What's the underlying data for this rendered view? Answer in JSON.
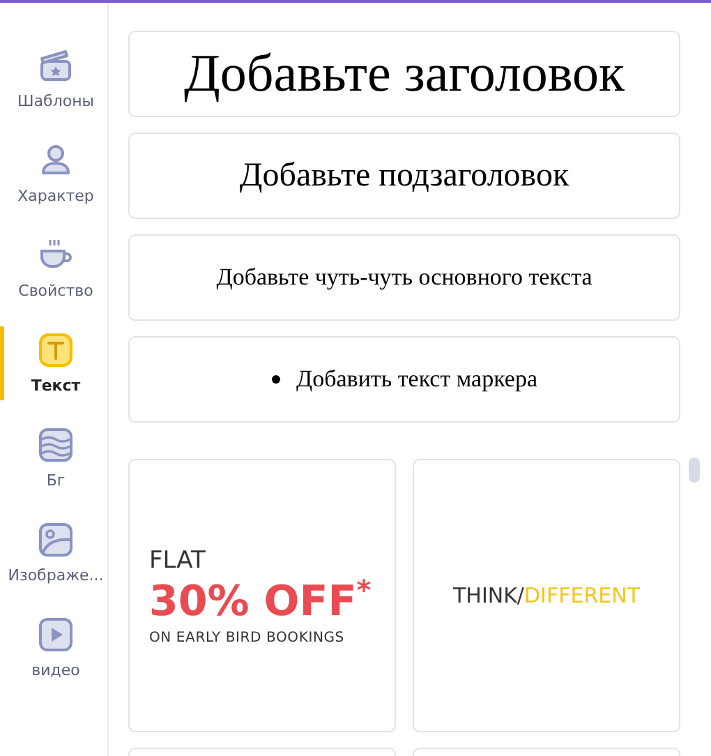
{
  "sidebar": {
    "items": [
      {
        "label": "Шаблоны",
        "kind": "templates",
        "selected": false
      },
      {
        "label": "Характер",
        "kind": "character",
        "selected": false
      },
      {
        "label": "Свойство",
        "kind": "property",
        "selected": false
      },
      {
        "label": "Текст",
        "kind": "text",
        "selected": true
      },
      {
        "label": "Бг",
        "kind": "background",
        "selected": false
      },
      {
        "label": "Изображе...",
        "kind": "image",
        "selected": false
      },
      {
        "label": "видео",
        "kind": "video",
        "selected": false
      }
    ]
  },
  "text_presets": [
    {
      "kind": "heading",
      "text": "Добавьте заголовок"
    },
    {
      "kind": "subheading",
      "text": "Добавьте подзаголовок"
    },
    {
      "kind": "body",
      "text": "Добавьте чуть-чуть основного текста"
    },
    {
      "kind": "bullet",
      "text": "Добавить текст маркера"
    }
  ],
  "templates": [
    {
      "kind": "sale",
      "top": "FLAT",
      "main": "30% OFF",
      "mark": "*",
      "bottom": "ON EARLY BIRD BOOKINGS"
    },
    {
      "kind": "split",
      "first": "THINK/",
      "second": "DIFFERENT"
    }
  ]
}
